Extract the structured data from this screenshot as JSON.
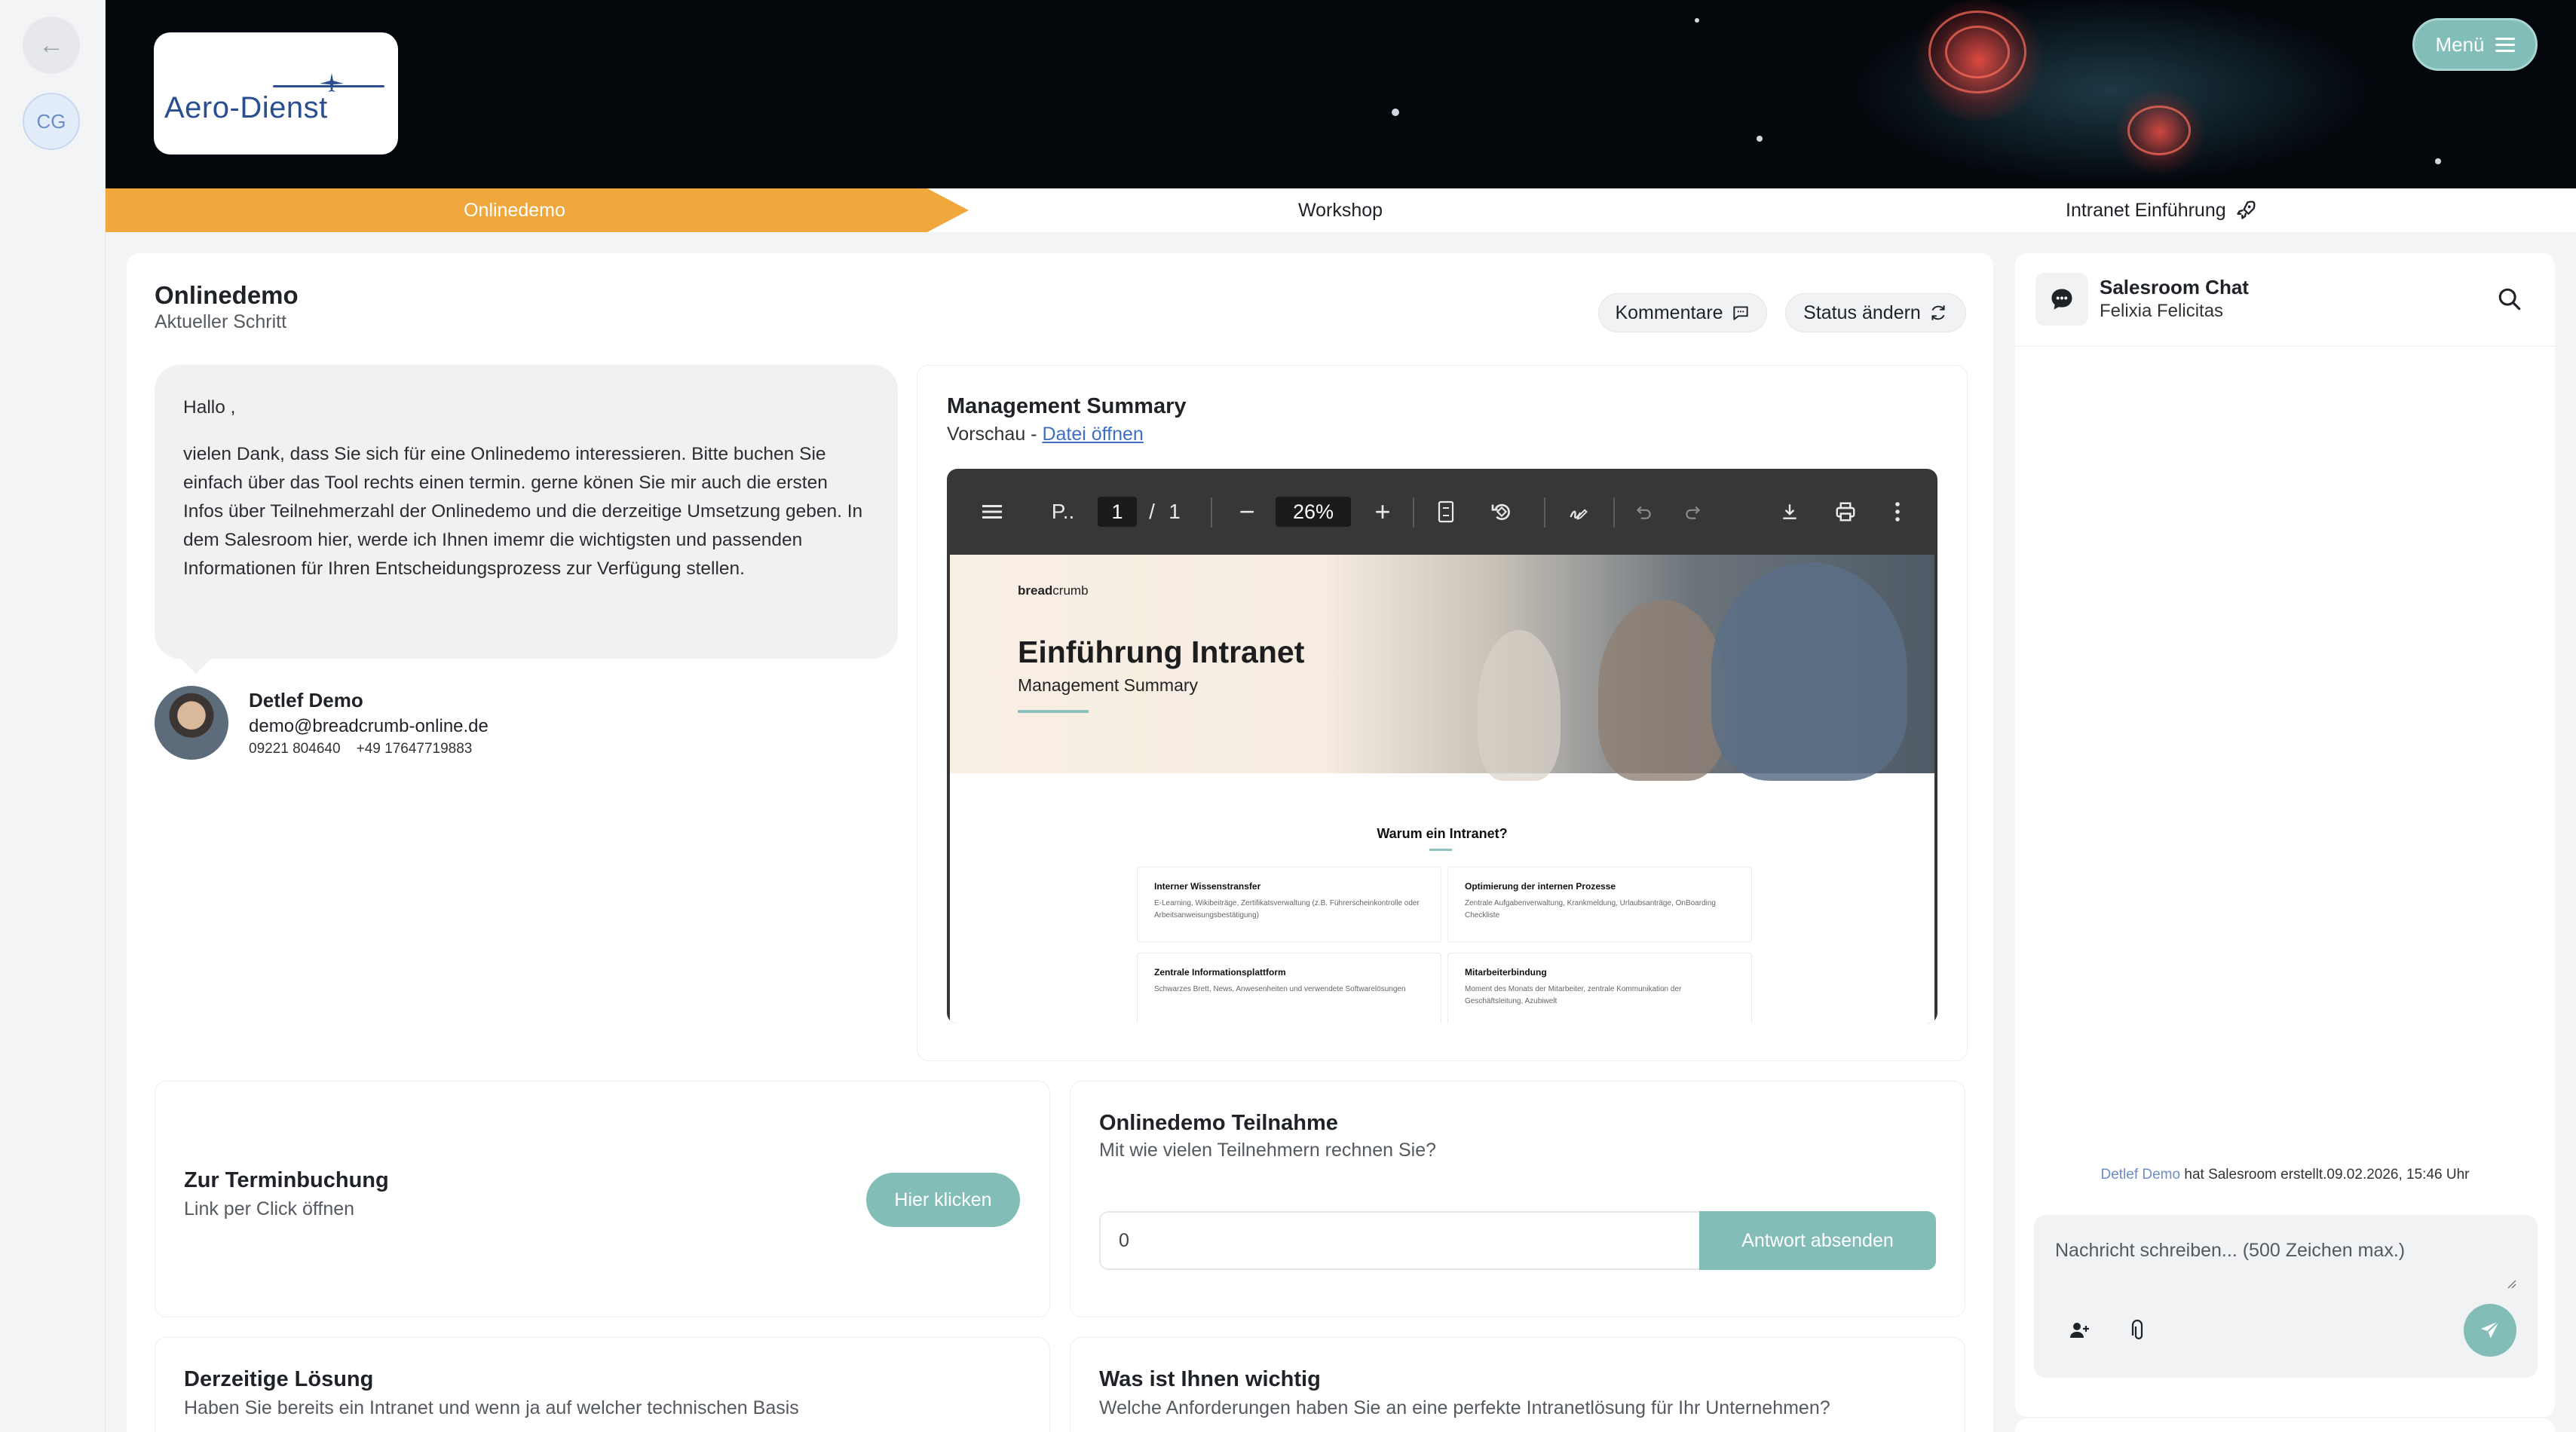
{
  "rail": {
    "back_icon": "←",
    "avatar_initials": "CG"
  },
  "header": {
    "logo_text": "Aero-Dienst",
    "menu_label": "Menü"
  },
  "steps": [
    {
      "label": "Onlinedemo",
      "active": true
    },
    {
      "label": "Workshop",
      "active": false
    },
    {
      "label": "Intranet Einführung",
      "active": false
    }
  ],
  "current_step": {
    "title": "Onlinedemo",
    "subtitle": "Aktueller Schritt",
    "comments_label": "Kommentare",
    "status_label": "Status ändern"
  },
  "message": {
    "greeting": "Hallo ,",
    "body": "vielen Dank, dass Sie sich für eine Onlinedemo interessieren. Bitte buchen Sie einfach über das Tool rechts einen termin. gerne könen Sie mir auch die ersten Infos über Teilnehmerzahl der Onlinedemo und die derzeitige Umsetzung geben. In dem Salesroom hier, werde ich Ihnen imemr die wichtigsten und passenden Informationen für Ihren Entscheidungsprozess zur Verfügung stellen."
  },
  "contact": {
    "name": "Detlef Demo",
    "email": "demo@breadcrumb-online.de",
    "phone": "09221 804640    +49 17647719883"
  },
  "management_summary": {
    "title": "Management Summary",
    "preview_label": "Vorschau -",
    "open_link": "Datei öffnen",
    "viewer": {
      "doc_name": "P..",
      "page_current": "1",
      "page_sep": "/",
      "page_total": "1",
      "zoom": "26%",
      "page": {
        "brand_bold": "bread",
        "brand_rest": "crumb",
        "title": "Einführung Intranet",
        "subtitle": "Management Summary",
        "question": "Warum ein Intranet?",
        "boxes": [
          {
            "title": "Interner Wissenstransfer",
            "text": "E-Learning, Wikibeiträge, Zertifikatsverwaltung (z.B. Führerscheinkontrolle oder Arbeitsanweisungsbestätigung)"
          },
          {
            "title": "Optimierung der internen Prozesse",
            "text": "Zentrale Aufgabenverwaltung, Krankmeldung, Urlaubsanträge, OnBoarding Checkliste"
          },
          {
            "title": "Zentrale Informationsplattform",
            "text": "Schwarzes Brett, News, Anwesenheiten und verwendete Softwarelösungen"
          },
          {
            "title": "Mitarbeiterbindung",
            "text": "Moment des Monats der Mitarbeiter, zentrale Kommunikation der Geschäftsleitung, Azubiwelt"
          }
        ]
      }
    }
  },
  "booking": {
    "title": "Zur Terminbuchung",
    "subtitle": "Link per Click öffnen",
    "button": "Hier klicken"
  },
  "participation": {
    "title": "Onlinedemo Teilnahme",
    "subtitle": "Mit wie vielen Teilnehmern rechnen Sie?",
    "value": "0",
    "button": "Antwort absenden"
  },
  "current_solution": {
    "title": "Derzeitige Lösung",
    "subtitle": "Haben Sie bereits ein Intranet und wenn ja auf welcher technischen Basis"
  },
  "importance": {
    "title": "Was ist Ihnen wichtig",
    "subtitle": "Welche Anforderungen haben Sie an eine perfekte Intranetlösung für Ihr Unternehmen?"
  },
  "chat": {
    "title": "Salesroom Chat",
    "subtitle": "Felixia Felicitas",
    "log_user": "Detlef Demo",
    "log_text": " hat Salesroom erstellt.09.02.2026, 15:46 Uhr",
    "placeholder": "Nachricht schreiben... (500 Zeichen max.)"
  },
  "colors": {
    "accent_teal": "#82bdb8",
    "step_orange": "#f0a73b",
    "link_blue": "#3f6fc0"
  }
}
